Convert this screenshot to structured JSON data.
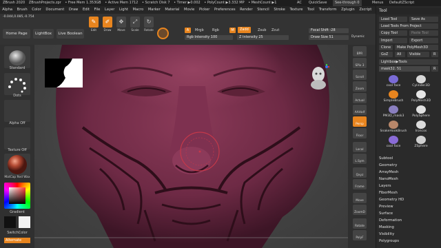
{
  "titlebar": {
    "items": [
      "ZBrush 2020",
      "ZBrushProjects.zpr",
      "• Free Mem 1.353GB",
      "• Active Mem 1712",
      "• Scratch Disk 7",
      "• Timer ▶0.002",
      "• PolyCount ▶3.332 MP",
      "• MeshCount ▶1"
    ],
    "ac": "AC",
    "quicksave": "QuickSave",
    "seethrough": "See-through  0",
    "menus_label": "Menus",
    "defaultscript": "DefaultZScript"
  },
  "menubar": {
    "items": [
      "Alpha",
      "Brush",
      "Color",
      "Document",
      "Draw",
      "Edit",
      "File",
      "Layer",
      "Light",
      "Macro",
      "Marker",
      "Material",
      "Movie",
      "Picker",
      "Preferences",
      "Render",
      "Stencil",
      "Stroke",
      "Texture",
      "Tool",
      "Transform",
      "Zplugin",
      "Zscript"
    ]
  },
  "shelf": {
    "coords": "-0.044,0.085,-0.754",
    "home_page": "Home Page",
    "lightbox": "LightBox",
    "live_boolean": "Live Boolean",
    "tools": [
      {
        "label": "Edit",
        "glyph": "✎",
        "active": true
      },
      {
        "label": "Draw",
        "glyph": "✐",
        "active": true
      },
      {
        "label": "Move",
        "glyph": "✥",
        "active": false
      },
      {
        "label": "Scale",
        "glyph": "⤢",
        "active": false
      },
      {
        "label": "Rotate",
        "glyph": "↻",
        "active": false
      }
    ],
    "a_label": "A",
    "mrgb": "Mrgb",
    "rgb": "Rgb",
    "m_label": "M",
    "zadd": "Zadd",
    "zsub": "Zsub",
    "zcut": "Zcut",
    "rgb_intensity": "Rgb Intensity 100",
    "z_intensity": "Z Intensity 25",
    "focal_shift": "Focal Shift -28",
    "draw_size": "Draw Size 51",
    "dynamic": "Dynamic"
  },
  "lefttray": {
    "standard": "Standard",
    "dots": "Dots",
    "alpha_off": "Alpha Off",
    "texture_off": "Texture Off",
    "matcap": "MatCap Red Wax",
    "gradient": "Gradient",
    "switchcolor": "SwitchColor",
    "alternate": "Alternate"
  },
  "rightshelf": {
    "buttons": [
      "BPR",
      "SPix 3",
      "Scroll",
      "Zoom",
      "Actual",
      "AAHalf",
      "Persp",
      "Floor",
      "Local",
      "L.Sym",
      "Qxyz",
      "Frame",
      "Move",
      "ZoomD",
      "Rotate",
      "PolyF"
    ],
    "spix_value": "3"
  },
  "palette": {
    "title": "Tool",
    "load_tool": "Load Tool",
    "save_as": "Save As",
    "load_tools_project": "Load Tools From Project",
    "copy_tool": "Copy Tool",
    "paste_tool": "Paste Tool",
    "import": "Import",
    "export": "Export",
    "clone": "Clone",
    "make_polymesh": "Make PolyMesh3D",
    "goz": "GoZ",
    "all": "All",
    "visible": "Visible",
    "r": "R",
    "lightbox_tools": "Lightbox▶Tools",
    "current_tool": "mask32. 51",
    "r2": "R",
    "tools": [
      "cool face",
      "Cylinder3D",
      "SimpleBrush",
      "PolyMesh3D",
      "PM3D_mask3",
      "PolySphere",
      "SnakeHookBrush",
      "Ironcos",
      "cool face",
      "ZSphere"
    ],
    "subpalettes": [
      "Subtool",
      "Geometry",
      "ArrayMesh",
      "NanoMesh",
      "Layers",
      "FiberMesh",
      "Geometry HD",
      "Preview",
      "Surface",
      "Deformation",
      "Masking",
      "Visibility",
      "Polygroups"
    ]
  },
  "colors": {
    "accent": "#e8851f",
    "skin": "#7a2f4a",
    "brush_ring": "#c4384a"
  }
}
